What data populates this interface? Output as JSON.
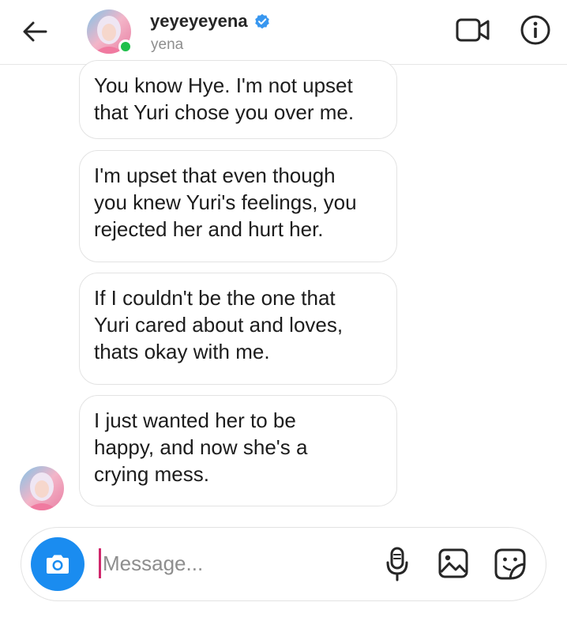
{
  "header": {
    "username": "yeyeyeyena",
    "subname": "yena",
    "icons": {
      "back": "arrow-left-icon",
      "verified": "verified-badge-icon",
      "video": "video-camera-icon",
      "info": "info-icon"
    }
  },
  "messages": [
    {
      "text": "You know Hye. I'm not upset\nthat Yuri chose you over me."
    },
    {
      "text": "I'm upset that even though\nyou knew Yuri's feelings, you\nrejected her and hurt her."
    },
    {
      "text": "If I couldn't be the one that\nYuri cared about and loves,\nthats okay with me."
    },
    {
      "text": "I just wanted her to be\nhappy, and now she's a\ncrying mess."
    }
  ],
  "composer": {
    "placeholder": "Message...",
    "value": "",
    "icons": {
      "camera": "camera-icon",
      "mic": "microphone-icon",
      "gallery": "image-gallery-icon",
      "sticker": "sticker-icon"
    }
  },
  "colors": {
    "accent_blue": "#1a8cf0",
    "verified_blue": "#3897f0",
    "online_green": "#1fbf4a",
    "caret_pink": "#d0286c",
    "text_secondary": "#8e8e8e",
    "bubble_border": "#e3e3e3"
  }
}
